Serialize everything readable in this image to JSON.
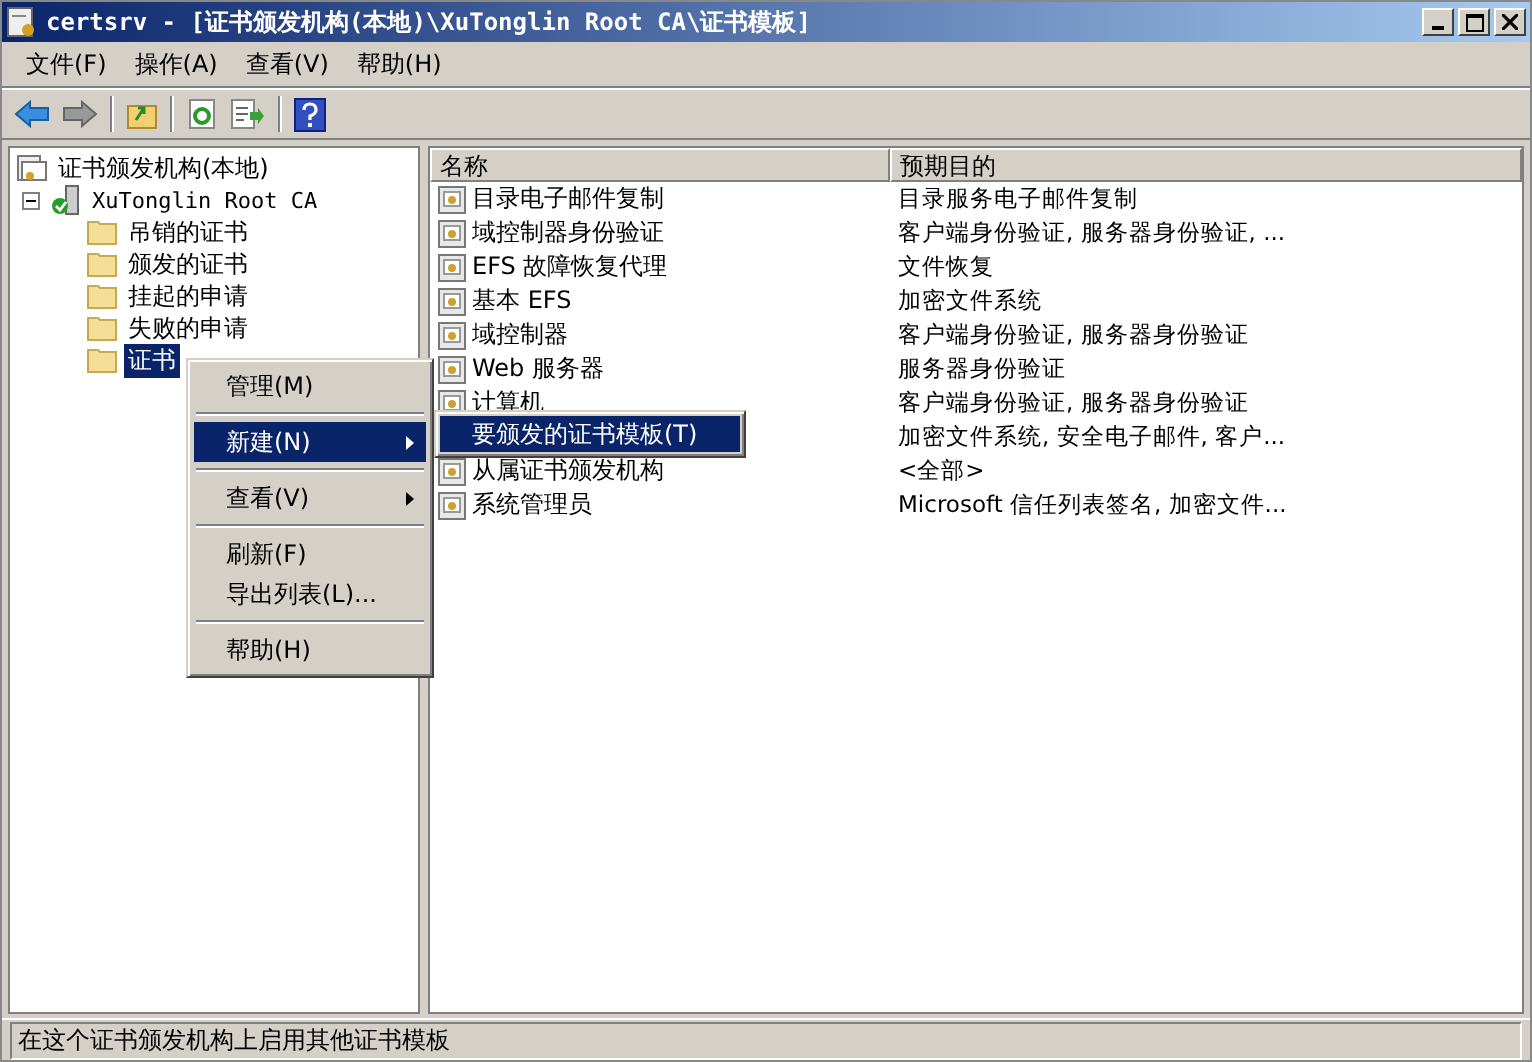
{
  "window": {
    "title": "certsrv - [证书颁发机构(本地)\\XuTonglin Root CA\\证书模板]"
  },
  "menu_bar": [
    "文件(F)",
    "操作(A)",
    "查看(V)",
    "帮助(H)"
  ],
  "tree": {
    "label": "证书颁发机构(本地)",
    "children": [
      {
        "label": "XuTonglin Root CA",
        "expanded": true,
        "children": [
          {
            "label": "吊销的证书",
            "selected": false
          },
          {
            "label": "颁发的证书",
            "selected": false
          },
          {
            "label": "挂起的申请",
            "selected": false
          },
          {
            "label": "失败的申请",
            "selected": false
          },
          {
            "label": "证书",
            "selected": true
          }
        ]
      }
    ]
  },
  "list": {
    "columns": [
      "名称",
      "预期目的"
    ],
    "rows": [
      {
        "name": "目录电子邮件复制",
        "purpose": "目录服务电子邮件复制"
      },
      {
        "name": "域控制器身份验证",
        "purpose": "客户端身份验证, 服务器身份验证, ..."
      },
      {
        "name": "EFS 故障恢复代理",
        "purpose": "文件恢复"
      },
      {
        "name": "基本 EFS",
        "purpose": "加密文件系统"
      },
      {
        "name": "域控制器",
        "purpose": "客户端身份验证, 服务器身份验证"
      },
      {
        "name": "Web 服务器",
        "purpose": "服务器身份验证"
      },
      {
        "name": "计算机",
        "purpose": "客户端身份验证, 服务器身份验证"
      },
      {
        "purpose": "加密文件系统, 安全电子邮件, 客户..."
      },
      {
        "name": "从属证书颁发机构",
        "purpose": "<全部>"
      },
      {
        "name": "系统管理员",
        "purpose": "Microsoft 信任列表签名, 加密文件..."
      }
    ]
  },
  "context_menu": {
    "groups": [
      [
        {
          "label": "管理(M)",
          "submenu": false,
          "selected": false
        }
      ],
      [
        {
          "label": "新建(N)",
          "submenu": true,
          "selected": true
        }
      ],
      [
        {
          "label": "查看(V)",
          "submenu": true,
          "selected": false
        }
      ],
      [
        {
          "label": "刷新(F)",
          "submenu": false,
          "selected": false
        },
        {
          "label": "导出列表(L)...",
          "submenu": false,
          "selected": false
        }
      ],
      [
        {
          "label": "帮助(H)",
          "submenu": false,
          "selected": false
        }
      ]
    ],
    "submenu": [
      {
        "label": "要颁发的证书模板(T)",
        "selected": true
      }
    ]
  },
  "status_bar": "在这个证书颁发机构上启用其他证书模板"
}
